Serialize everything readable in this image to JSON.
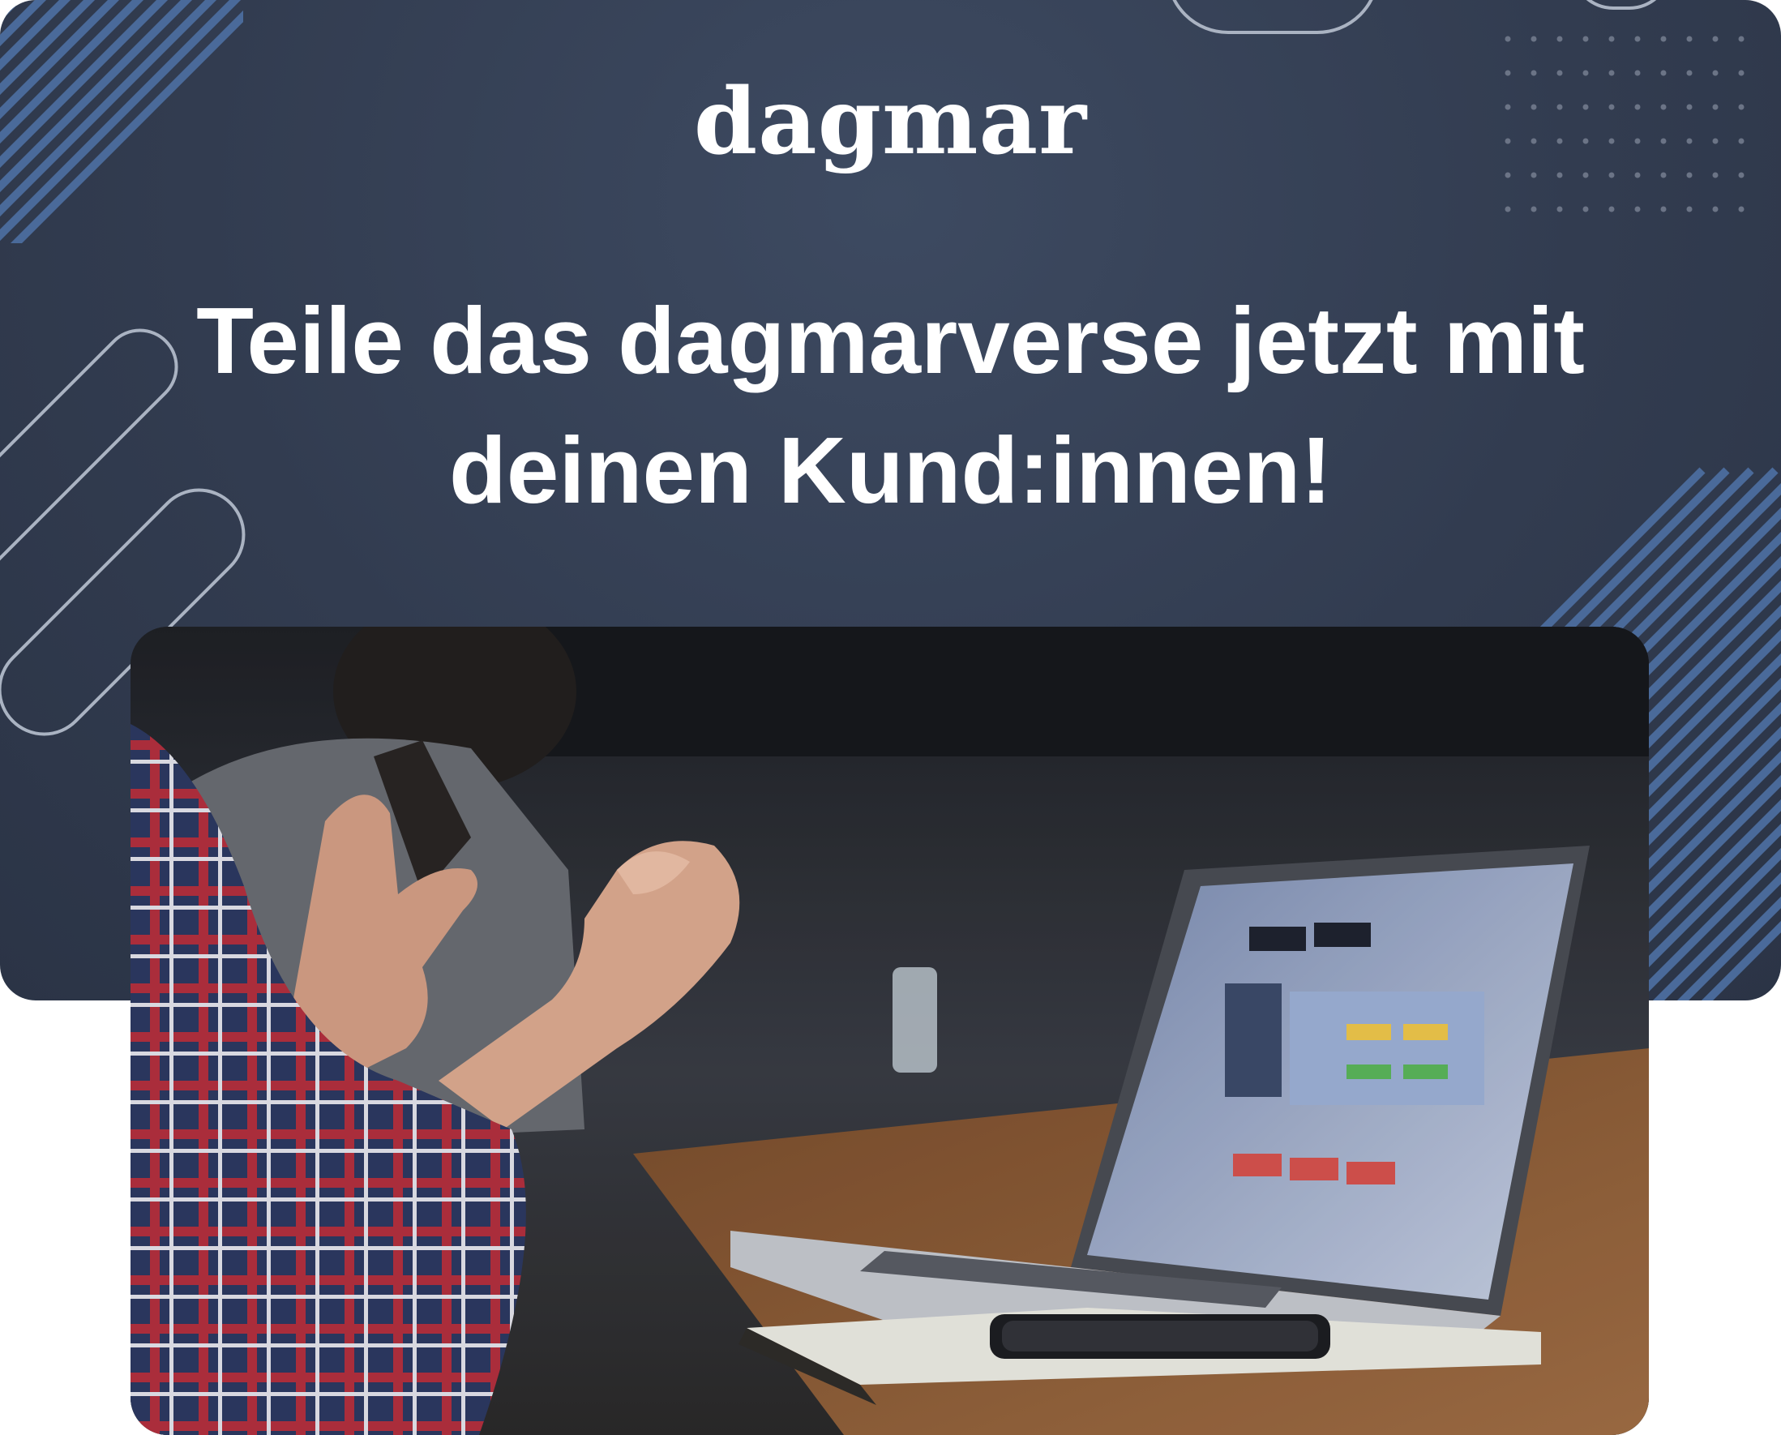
{
  "brand": {
    "logo_text": "dagmar"
  },
  "headline": {
    "line1": "Teile das dagmarverse jetzt mit",
    "line2": "deinen Kund:innen!"
  },
  "colors": {
    "background": "#333d51",
    "stripes": "#4a6a9a",
    "outline": "#aab3c2",
    "text": "#ffffff"
  },
  "photo": {
    "icon": "meeting-photo"
  }
}
